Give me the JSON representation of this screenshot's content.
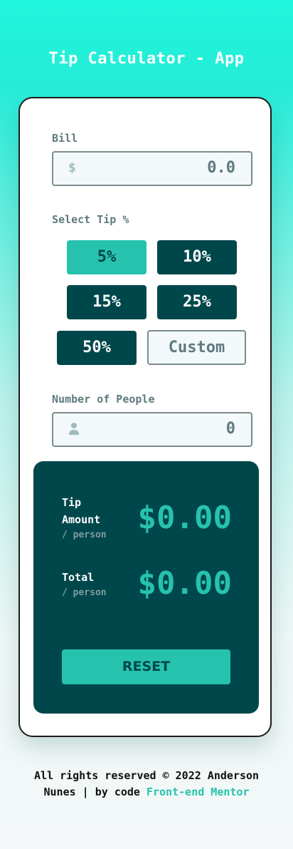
{
  "app_title": "Tip Calculator - App",
  "bill": {
    "label": "Bill",
    "currency_symbol": "$",
    "value": "0.0"
  },
  "tip": {
    "label": "Select Tip %",
    "options": [
      "5%",
      "10%",
      "15%",
      "25%",
      "50%"
    ],
    "selected": "5%",
    "custom_placeholder": "Custom"
  },
  "people": {
    "label": "Number of People",
    "value": "0",
    "icon": "person-icon"
  },
  "result": {
    "tip_amount_label_1": "Tip",
    "tip_amount_label_2": "Amount",
    "tip_amount_sub": "/ person",
    "tip_amount_value": "$0.00",
    "total_label": "Total",
    "total_sub": "/ person",
    "total_value": "$0.00",
    "reset_label": "RESET"
  },
  "footer": {
    "line1": "All rights reserved © 2022 Anderson",
    "line2_text": "Nunes | by code ",
    "link": "Front-end Mentor"
  },
  "colors": {
    "accent": "#26c2ad",
    "dark": "#00474b",
    "muted": "#5e7a7d"
  }
}
